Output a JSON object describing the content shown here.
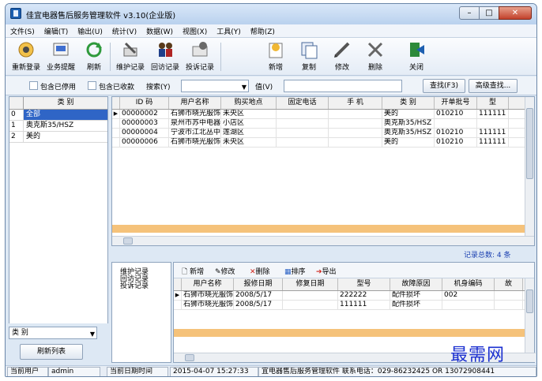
{
  "window": {
    "title": "佳宜电器售后服务管理软件 v3.10(企业版)"
  },
  "menu": [
    "文件(S)",
    "编辑(T)",
    "输出(U)",
    "统计(V)",
    "数据(W)",
    "视图(X)",
    "工具(Y)",
    "帮助(Z)"
  ],
  "toolbar": {
    "relogin": "重新登录",
    "reminder": "业务提醒",
    "refresh": "刷新",
    "maintenance": "维护记录",
    "visit": "回访记录",
    "complaint": "投诉记录",
    "add": "新增",
    "copy": "复制",
    "edit": "修改",
    "delete": "删除",
    "close": "关闭"
  },
  "search": {
    "include_disabled": "包含已停用",
    "include_received": "包含已收款",
    "search_label": "搜索(Y)",
    "value_label": "值(V)",
    "find_button": "查找(F3)",
    "advanced_button": "高级查找..."
  },
  "categories": {
    "header": "类  别",
    "rows": [
      {
        "idx": "0",
        "name": "全部"
      },
      {
        "idx": "1",
        "name": "奥克斯35/HSZ"
      },
      {
        "idx": "2",
        "name": "美的"
      }
    ],
    "filter_label": "类  别",
    "refresh_button": "刷新列表"
  },
  "main_grid": {
    "headers": [
      "ID  码",
      "用户名称",
      "购买地点",
      "固定电话",
      "手  机",
      "类  别",
      "开单批号",
      "型"
    ],
    "rows": [
      [
        "00000002",
        "石狮市晓光服饰有限公司",
        "未央区",
        "",
        "",
        "美的",
        "010210",
        "111111"
      ],
      [
        "00000003",
        "泉州市苏中电器有限公司",
        "小店区",
        "",
        "",
        "奥克斯35/HSZ",
        "",
        ""
      ],
      [
        "00000004",
        "宁波市江北丛中建筑公司",
        "莲湖区",
        "",
        "",
        "奥克斯35/HSZ",
        "010210",
        "111111"
      ],
      [
        "00000006",
        "石狮市晓光服饰有限公司",
        "未央区",
        "",
        "",
        "美的",
        "010210",
        "111111"
      ]
    ],
    "record_count_label": "记录总数:",
    "record_count": "4 条"
  },
  "sub_left": [
    "维护记录",
    "回访记录",
    "投诉记录"
  ],
  "sub_toolbar": {
    "add": "新增",
    "edit": "修改",
    "delete": "删除",
    "sort": "排序",
    "export": "导出"
  },
  "sub_grid": {
    "headers": [
      "用户名称",
      "报修日期",
      "修复日期",
      "型号",
      "故障原因",
      "机身编码",
      "故"
    ],
    "rows": [
      [
        "石狮市晓光服饰有限公司",
        "2008/5/17",
        "",
        "222222",
        "配件损坏",
        "002",
        ""
      ],
      [
        "石狮市晓光服饰有限公司",
        "2008/5/17",
        "",
        "111111",
        "配件损坏",
        "",
        ""
      ]
    ]
  },
  "status": {
    "user_label": "当前用户",
    "user": "admin",
    "date_label": "当前日期时间",
    "datetime": "2015-04-07 15:27:33",
    "info": "宜电器售后服务管理软件  联系电话：029-86232425 OR 13072908441"
  },
  "watermark": "最需网"
}
